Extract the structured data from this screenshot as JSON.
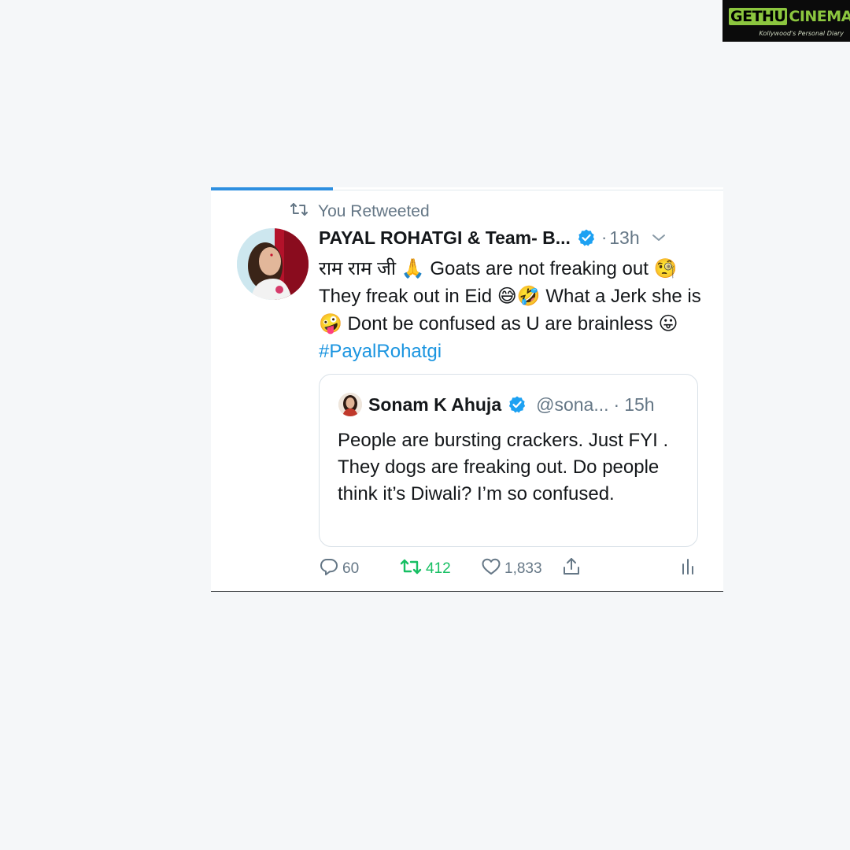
{
  "watermark": {
    "brand_left": "GETHU",
    "brand_right": "CINEMA",
    "tagline": "Kollywood's Personal Diary"
  },
  "retweet_banner": {
    "label": "You Retweeted",
    "icon": "retweet-icon"
  },
  "tweet": {
    "author_name": "PAYAL ROHATGI & Team- B...",
    "verified_icon": "verified-badge-icon",
    "separator": "·",
    "time": "13h",
    "text_parts": [
      "राम राम जी ",
      "🙏",
      " Goats are not freaking out ",
      "🧐",
      " They freak out in Eid ",
      "😅🤣",
      " What a Jerk she is ",
      "🤪",
      " Dont be confused as U are brainless ",
      "😛",
      " "
    ],
    "hashtag": "#PayalRohatgi"
  },
  "quoted_tweet": {
    "author_name": "Sonam K Ahuja",
    "handle": "@sona...",
    "separator": "·",
    "time": "15h",
    "text": "People are bursting crackers. Just FYI . They dogs are freaking out. Do people think it’s Diwali? I’m so confused."
  },
  "actions": {
    "reply_count": "60",
    "retweet_count": "412",
    "like_count": "1,833"
  },
  "colors": {
    "accent": "#1b95e0",
    "retweet_active": "#17bf63",
    "secondary_text": "#657786",
    "background": "#f5f7f9"
  }
}
